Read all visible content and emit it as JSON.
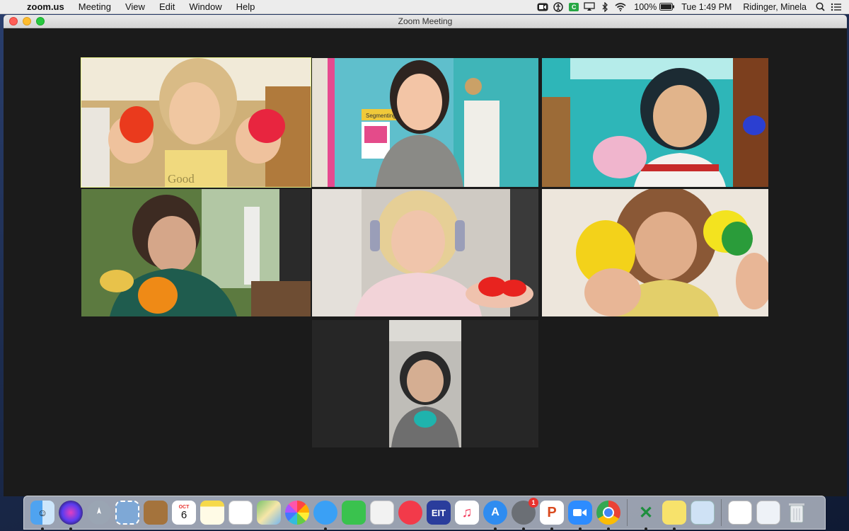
{
  "menubar": {
    "apple_glyph": "",
    "app_name": "zoom.us",
    "menus": [
      "Meeting",
      "View",
      "Edit",
      "Window",
      "Help"
    ],
    "tray_icons": [
      "zoom-tray-icon",
      "accessibility-icon",
      "green-c-icon",
      "airplay-icon",
      "bluetooth-icon",
      "wifi-icon"
    ],
    "battery": "100%",
    "clock": "Tue 1:49 PM",
    "user": "Ridinger, Minela",
    "tray_c_label": "C"
  },
  "window": {
    "title": "Zoom Meeting"
  },
  "participants": [
    {
      "id": "p1",
      "active": true,
      "shirt_text": "Good",
      "bg": "#c9a56a",
      "person": "#e8b98e",
      "item": "#e8361e"
    },
    {
      "id": "p2",
      "active": false,
      "poster_text": "Segmenting",
      "bg": "#5bb7c6",
      "person": "#6f6f6f",
      "item": "#e94f8d"
    },
    {
      "id": "p3",
      "active": false,
      "bg": "#31b4b7",
      "person": "#d3a07a",
      "item": "#f1a9c7"
    },
    {
      "id": "p4",
      "active": false,
      "bg": "#5f7a45",
      "person": "#c89a7a",
      "item": "#f08a16"
    },
    {
      "id": "p5",
      "active": false,
      "bg": "#c6c2bc",
      "person": "#e6b9a0",
      "item": "#e8231f"
    },
    {
      "id": "p6",
      "active": false,
      "bg": "#e2d8cf",
      "person": "#d4a17f",
      "item": "#f3d21a"
    },
    {
      "id": "p7",
      "active": false,
      "bg": "#8a8a86",
      "person": "#c7a28a",
      "item": "#1fb3ad"
    }
  ],
  "dock": {
    "calendar_month": "OCT",
    "calendar_day": "6",
    "eit_label": "EIT",
    "sysprefs_badge": "1",
    "apps": [
      "finder-icon",
      "siri-icon",
      "launchpad-icon",
      "mail-stamp-icon",
      "contacts-icon",
      "calendar-icon",
      "notes-icon",
      "reminders-icon",
      "maps-icon",
      "photos-icon",
      "messages-icon",
      "facetime-icon",
      "keynote-icon",
      "news-icon",
      "eit-icon",
      "music-icon",
      "app-store-icon",
      "system-preferences-icon",
      "powerpoint-icon",
      "zoom-icon",
      "chrome-icon",
      "excel-icon",
      "stickies-icon",
      "preview-icon",
      "document-icon",
      "screenshot-icon",
      "trash-icon"
    ]
  },
  "colors": {
    "active_speaker_outline": "#e8f28a",
    "window_bg": "#1b1b1b"
  }
}
